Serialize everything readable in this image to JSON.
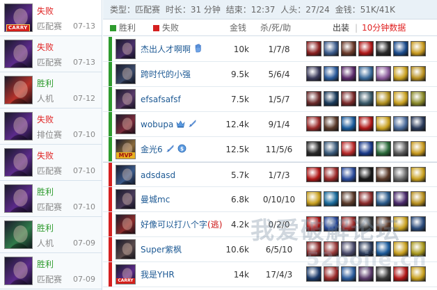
{
  "history": [
    {
      "result": "失败",
      "result_type": "lose",
      "mode": "匹配赛",
      "date": "07-13",
      "badge": "CARRY",
      "champ_color": "#5b2a8a"
    },
    {
      "result": "失败",
      "result_type": "lose",
      "mode": "匹配赛",
      "date": "07-13",
      "badge": "",
      "champ_color": "#5b2a8a"
    },
    {
      "result": "胜利",
      "result_type": "win",
      "mode": "人机",
      "date": "07-12",
      "badge": "",
      "champ_color": "#b8322a"
    },
    {
      "result": "失败",
      "result_type": "lose",
      "mode": "排位赛",
      "date": "07-10",
      "badge": "",
      "champ_color": "#5b2a8a"
    },
    {
      "result": "失败",
      "result_type": "lose",
      "mode": "匹配赛",
      "date": "07-10",
      "badge": "",
      "champ_color": "#5b2a8a"
    },
    {
      "result": "胜利",
      "result_type": "win",
      "mode": "匹配赛",
      "date": "07-10",
      "badge": "",
      "champ_color": "#5b2a8a"
    },
    {
      "result": "胜利",
      "result_type": "win",
      "mode": "人机",
      "date": "07-09",
      "badge": "",
      "champ_color": "#2f7a4a"
    },
    {
      "result": "胜利",
      "result_type": "win",
      "mode": "匹配赛",
      "date": "07-09",
      "badge": "",
      "champ_color": "#5b2a8a"
    }
  ],
  "summary": {
    "type": "类型：匹配赛",
    "duration": "时长：31 分钟",
    "end": "结束：12:37",
    "kills": "人头：27/24",
    "gold": "金钱：51K/41K"
  },
  "header": {
    "win": "胜利",
    "lose": "失败",
    "gold": "金钱",
    "kda": "杀/死/助",
    "build": "出装",
    "sep": "|",
    "ten_min": "10分钟数据",
    "win_color": "#2e9b2e",
    "lose_color": "#d52020"
  },
  "players": [
    {
      "team": "win",
      "name": "杰出人才啊啊",
      "gold": "10k",
      "kda": "1/7/8",
      "champ_color": "#4a2f6b",
      "icons": [
        "hand-icon"
      ],
      "badge": ""
    },
    {
      "team": "win",
      "name": "跨时代的小强",
      "gold": "9.5k",
      "kda": "5/6/4",
      "champ_color": "#3a4a6a",
      "icons": [],
      "badge": ""
    },
    {
      "team": "win",
      "name": "efsafsafsf",
      "gold": "7.5k",
      "kda": "1/5/7",
      "champ_color": "#5a3a6a",
      "icons": [],
      "badge": ""
    },
    {
      "team": "win",
      "name": "wobupa",
      "gold": "12.4k",
      "kda": "9/1/4",
      "champ_color": "#7a2a3a",
      "icons": [
        "crown-icon",
        "sword-icon"
      ],
      "badge": ""
    },
    {
      "team": "win",
      "name": "金光6",
      "gold": "12.5k",
      "kda": "11/5/6",
      "champ_color": "#8a6a3a",
      "icons": [
        "sword-icon",
        "coin-icon"
      ],
      "badge": "MVP"
    },
    {
      "team": "lose",
      "name": "adsdasd",
      "gold": "5.7k",
      "kda": "1/7/3",
      "champ_color": "#3a5a8a",
      "icons": [],
      "badge": ""
    },
    {
      "team": "lose",
      "name": "曼城mc",
      "gold": "6.8k",
      "kda": "0/10/10",
      "champ_color": "#4a3a5a",
      "icons": [],
      "badge": ""
    },
    {
      "team": "lose",
      "name": "好像可以打八个字",
      "tag": "(逃)",
      "gold": "4.2k",
      "kda": "0/2/0",
      "champ_color": "#8a2a2a",
      "icons": [],
      "badge": ""
    },
    {
      "team": "lose",
      "name": "Super紫枫",
      "gold": "10.6k",
      "kda": "6/5/10",
      "champ_color": "#5a4a4a",
      "icons": [],
      "badge": ""
    },
    {
      "team": "lose",
      "name": "我是YHR",
      "gold": "14k",
      "kda": "17/4/3",
      "champ_color": "#5b2a8a",
      "icons": [],
      "badge": "CARRY"
    }
  ],
  "items": [
    [
      "#8a2020",
      "#3a5a8a",
      "#6a3a2a",
      "#b01818",
      "#2a2a2a",
      "#1a4a8a",
      "#c89a20"
    ],
    [
      "#3a3a5a",
      "#2a5a9a",
      "#5a2a6a",
      "#3a6a9a",
      "#8a5a9a",
      "#c8a020",
      "#b89020"
    ],
    [
      "#6a2a2a",
      "#1a3a5a",
      "#7a2a2a",
      "#3a5a6a",
      "#b09020",
      "#c8a020",
      "#8a8a2a"
    ],
    [
      "#9a2a2a",
      "#5a3a2a",
      "#1a5a9a",
      "#b01818",
      "#c8a020",
      "#4a6a9a",
      "#2a3a5a"
    ],
    [
      "#2a2a2a",
      "#3a5a7a",
      "#b82a2a",
      "#1a3a8a",
      "#2a6a3a",
      "#5a5a5a",
      "#c89a20"
    ],
    [
      "#b01818",
      "#9a2a2a",
      "#2a4a9a",
      "#1a1a1a",
      "#5a3a2a",
      "#6a6a6a",
      "#c8a020"
    ],
    [
      "#c8a020",
      "#1a6a9a",
      "#5a3a2a",
      "#8a2a2a",
      "#2a5a8a",
      "#4a2a6a",
      "#b89020"
    ],
    [
      "#b01818",
      "#2a4a9a",
      "#9a2a2a",
      "#3a3a3a",
      "#5a3a2a",
      "#c8a020",
      "#2a4a7a"
    ],
    [
      "#8a2a2a",
      "#9a3a3a",
      "#4a4a6a",
      "#2a3a5a",
      "#1a5a9a",
      "#c8a020",
      "#aa9a20"
    ],
    [
      "#1a3a6a",
      "#9a2a2a",
      "#2a5a9a",
      "#5a3a6a",
      "#3a3a3a",
      "#b01818",
      "#c8a020"
    ]
  ],
  "watermark": {
    "line1": "我爱破解论坛",
    "line2": "52pojie.cn"
  }
}
